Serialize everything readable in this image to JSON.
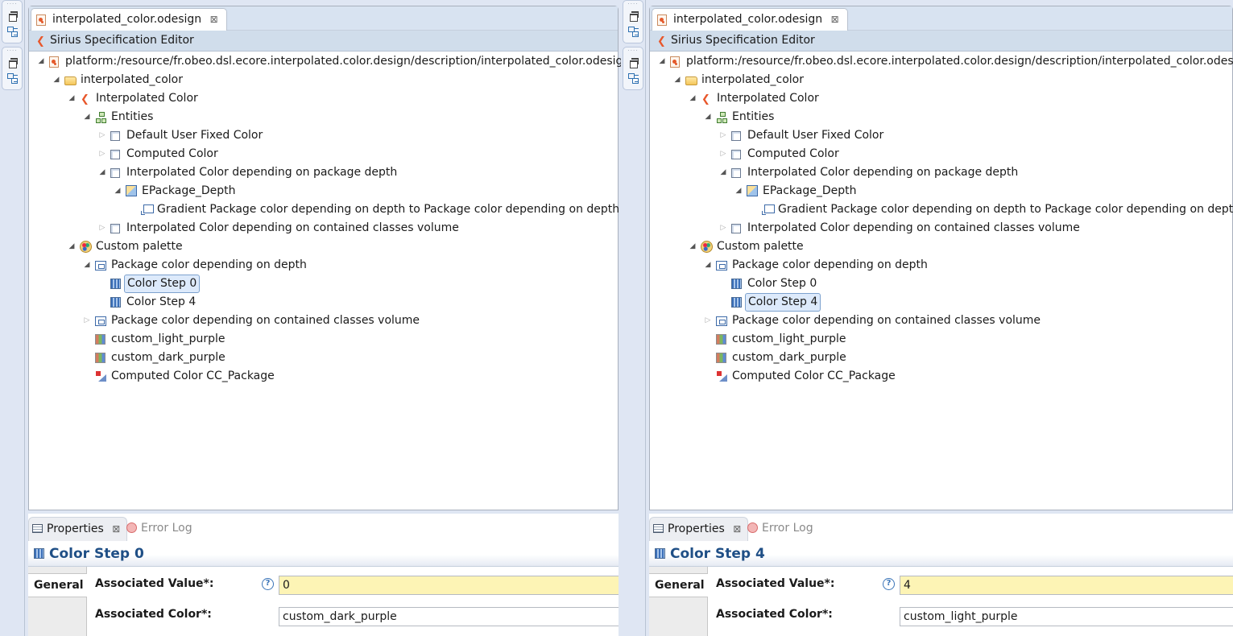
{
  "panes": [
    {
      "editor_tab": {
        "label": "interpolated_color.odesign",
        "close_glyph": "⊠"
      },
      "editor_header": "Sirius Specification Editor",
      "tree": [
        {
          "depth": 0,
          "twisty": "open",
          "icon": "odesign-file-icon",
          "label": "platform:/resource/fr.obeo.dsl.ecore.interpolated.color.design/description/interpolated_color.odesign"
        },
        {
          "depth": 1,
          "twisty": "open",
          "icon": "folder-icon",
          "label": "interpolated_color"
        },
        {
          "depth": 2,
          "twisty": "open",
          "icon": "sirius-viewpoint-icon",
          "label": "Interpolated Color"
        },
        {
          "depth": 3,
          "twisty": "open",
          "icon": "entities-icon",
          "label": "Entities"
        },
        {
          "depth": 4,
          "twisty": "closed",
          "icon": "container-icon",
          "label": "Default User Fixed Color"
        },
        {
          "depth": 4,
          "twisty": "closed",
          "icon": "container-icon",
          "label": "Computed Color"
        },
        {
          "depth": 4,
          "twisty": "open",
          "icon": "container-icon",
          "label": "Interpolated Color depending on package depth"
        },
        {
          "depth": 5,
          "twisty": "open",
          "icon": "node-mapping-icon",
          "label": "EPackage_Depth"
        },
        {
          "depth": 6,
          "twisty": "none",
          "icon": "gradient-style-icon",
          "label": "Gradient Package color depending on depth to Package color depending on depth"
        },
        {
          "depth": 4,
          "twisty": "closed",
          "icon": "container-icon",
          "label": "Interpolated Color depending on contained classes volume"
        },
        {
          "depth": 2,
          "twisty": "open",
          "icon": "palette-icon",
          "label": "Custom palette"
        },
        {
          "depth": 3,
          "twisty": "open",
          "icon": "interpolated-color-icon",
          "label": "Package color depending on depth"
        },
        {
          "depth": 4,
          "twisty": "none",
          "icon": "color-step-icon",
          "label": "Color Step 0",
          "selected": true
        },
        {
          "depth": 4,
          "twisty": "none",
          "icon": "color-step-icon",
          "label": "Color Step 4"
        },
        {
          "depth": 3,
          "twisty": "closed",
          "icon": "interpolated-color-icon",
          "label": "Package color depending on contained classes volume"
        },
        {
          "depth": 3,
          "twisty": "none",
          "icon": "user-color-icon",
          "label": "custom_light_purple"
        },
        {
          "depth": 3,
          "twisty": "none",
          "icon": "user-color-icon",
          "label": "custom_dark_purple"
        },
        {
          "depth": 3,
          "twisty": "none",
          "icon": "computed-color-icon",
          "label": "Computed Color CC_Package"
        }
      ],
      "properties": {
        "tabs": [
          {
            "label": "Properties",
            "active": true,
            "close_glyph": "⊠"
          },
          {
            "label": "Error Log",
            "active": false
          }
        ],
        "title": "Color Step 0",
        "side_tab": "General",
        "associated_value_label": "Associated Value*:",
        "associated_value": "0",
        "associated_color_label": "Associated Color*:",
        "associated_color": "custom_dark_purple",
        "help_glyph": "?"
      }
    },
    {
      "editor_tab": {
        "label": "interpolated_color.odesign",
        "close_glyph": "⊠"
      },
      "editor_header": "Sirius Specification Editor",
      "tree": [
        {
          "depth": 0,
          "twisty": "open",
          "icon": "odesign-file-icon",
          "label": "platform:/resource/fr.obeo.dsl.ecore.interpolated.color.design/description/interpolated_color.odesign"
        },
        {
          "depth": 1,
          "twisty": "open",
          "icon": "folder-icon",
          "label": "interpolated_color"
        },
        {
          "depth": 2,
          "twisty": "open",
          "icon": "sirius-viewpoint-icon",
          "label": "Interpolated Color"
        },
        {
          "depth": 3,
          "twisty": "open",
          "icon": "entities-icon",
          "label": "Entities"
        },
        {
          "depth": 4,
          "twisty": "closed",
          "icon": "container-icon",
          "label": "Default User Fixed Color"
        },
        {
          "depth": 4,
          "twisty": "closed",
          "icon": "container-icon",
          "label": "Computed Color"
        },
        {
          "depth": 4,
          "twisty": "open",
          "icon": "container-icon",
          "label": "Interpolated Color depending on package depth"
        },
        {
          "depth": 5,
          "twisty": "open",
          "icon": "node-mapping-icon",
          "label": "EPackage_Depth"
        },
        {
          "depth": 6,
          "twisty": "none",
          "icon": "gradient-style-icon",
          "label": "Gradient Package color depending on depth to Package color depending on depth"
        },
        {
          "depth": 4,
          "twisty": "closed",
          "icon": "container-icon",
          "label": "Interpolated Color depending on contained classes volume"
        },
        {
          "depth": 2,
          "twisty": "open",
          "icon": "palette-icon",
          "label": "Custom palette"
        },
        {
          "depth": 3,
          "twisty": "open",
          "icon": "interpolated-color-icon",
          "label": "Package color depending on depth"
        },
        {
          "depth": 4,
          "twisty": "none",
          "icon": "color-step-icon",
          "label": "Color Step 0"
        },
        {
          "depth": 4,
          "twisty": "none",
          "icon": "color-step-icon",
          "label": "Color Step 4",
          "selected": true
        },
        {
          "depth": 3,
          "twisty": "closed",
          "icon": "interpolated-color-icon",
          "label": "Package color depending on contained classes volume"
        },
        {
          "depth": 3,
          "twisty": "none",
          "icon": "user-color-icon",
          "label": "custom_light_purple"
        },
        {
          "depth": 3,
          "twisty": "none",
          "icon": "user-color-icon",
          "label": "custom_dark_purple"
        },
        {
          "depth": 3,
          "twisty": "none",
          "icon": "computed-color-icon",
          "label": "Computed Color CC_Package"
        }
      ],
      "properties": {
        "tabs": [
          {
            "label": "Properties",
            "active": true,
            "close_glyph": "⊠"
          },
          {
            "label": "Error Log",
            "active": false
          }
        ],
        "title": "Color Step 4",
        "side_tab": "General",
        "associated_value_label": "Associated Value*:",
        "associated_value": "4",
        "associated_color_label": "Associated Color*:",
        "associated_color": "custom_light_purple",
        "help_glyph": "?"
      }
    }
  ],
  "trim_icons": [
    "restore-icon",
    "outline-icon",
    "restore-icon",
    "outline-icon"
  ],
  "colors": {
    "selection_bg": "#ddeafb",
    "selection_border": "#7da2ce",
    "required_field_bg": "#fdf4b5",
    "title_text": "#1f4f86"
  }
}
